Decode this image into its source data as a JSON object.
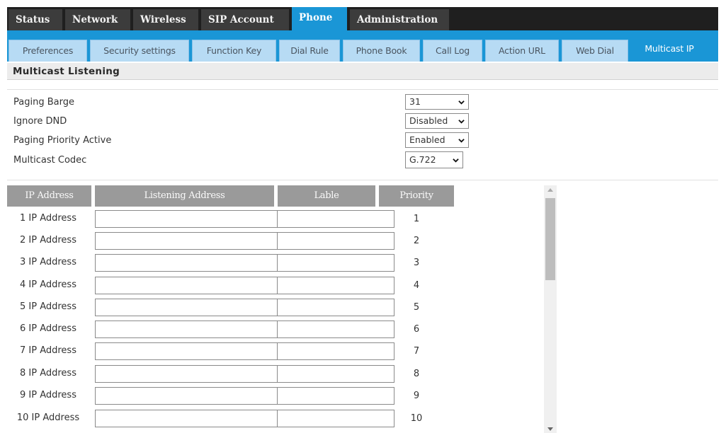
{
  "main_tabs": [
    {
      "label": "Status"
    },
    {
      "label": "Network"
    },
    {
      "label": "Wireless"
    },
    {
      "label": "SIP Account"
    },
    {
      "label": "Phone"
    },
    {
      "label": "Administration"
    }
  ],
  "main_tabs_active": "Phone",
  "sub_tabs": [
    {
      "label": "Preferences"
    },
    {
      "label": "Security settings"
    },
    {
      "label": "Function Key"
    },
    {
      "label": "Dial Rule"
    },
    {
      "label": "Phone Book"
    },
    {
      "label": "Call Log"
    },
    {
      "label": "Action URL"
    },
    {
      "label": "Web Dial"
    },
    {
      "label": "Multicast IP"
    }
  ],
  "sub_tabs_active": "Multicast IP",
  "section": {
    "title": "Multicast Listening"
  },
  "settings": [
    {
      "label": "Paging Barge",
      "value": "31"
    },
    {
      "label": "Ignore DND",
      "value": "Disabled"
    },
    {
      "label": "Paging Priority Active",
      "value": "Enabled"
    },
    {
      "label": "Multicast Codec",
      "value": "G.722"
    }
  ],
  "table": {
    "headers": {
      "ip_address": "IP Address",
      "listening_address": "Listening Address",
      "label": "Lable",
      "priority": "Priority"
    },
    "rows": [
      {
        "label": "1 IP Address",
        "listening_address": "",
        "label_value": "",
        "priority": "1"
      },
      {
        "label": "2 IP Address",
        "listening_address": "",
        "label_value": "",
        "priority": "2"
      },
      {
        "label": "3 IP Address",
        "listening_address": "",
        "label_value": "",
        "priority": "3"
      },
      {
        "label": "4 IP Address",
        "listening_address": "",
        "label_value": "",
        "priority": "4"
      },
      {
        "label": "5 IP Address",
        "listening_address": "",
        "label_value": "",
        "priority": "5"
      },
      {
        "label": "6 IP Address",
        "listening_address": "",
        "label_value": "",
        "priority": "6"
      },
      {
        "label": "7 IP Address",
        "listening_address": "",
        "label_value": "",
        "priority": "7"
      },
      {
        "label": "8 IP Address",
        "listening_address": "",
        "label_value": "",
        "priority": "8"
      },
      {
        "label": "9 IP Address",
        "listening_address": "",
        "label_value": "",
        "priority": "9"
      },
      {
        "label": "10 IP Address",
        "listening_address": "",
        "label_value": "",
        "priority": "10"
      }
    ]
  },
  "colors": {
    "accent": "#1a96d6",
    "main_tab_bar": "#1f1f1f",
    "main_tab": "#3c3c3c",
    "sub_tab": "#b7dbf4",
    "table_header": "#9a9a9a"
  }
}
